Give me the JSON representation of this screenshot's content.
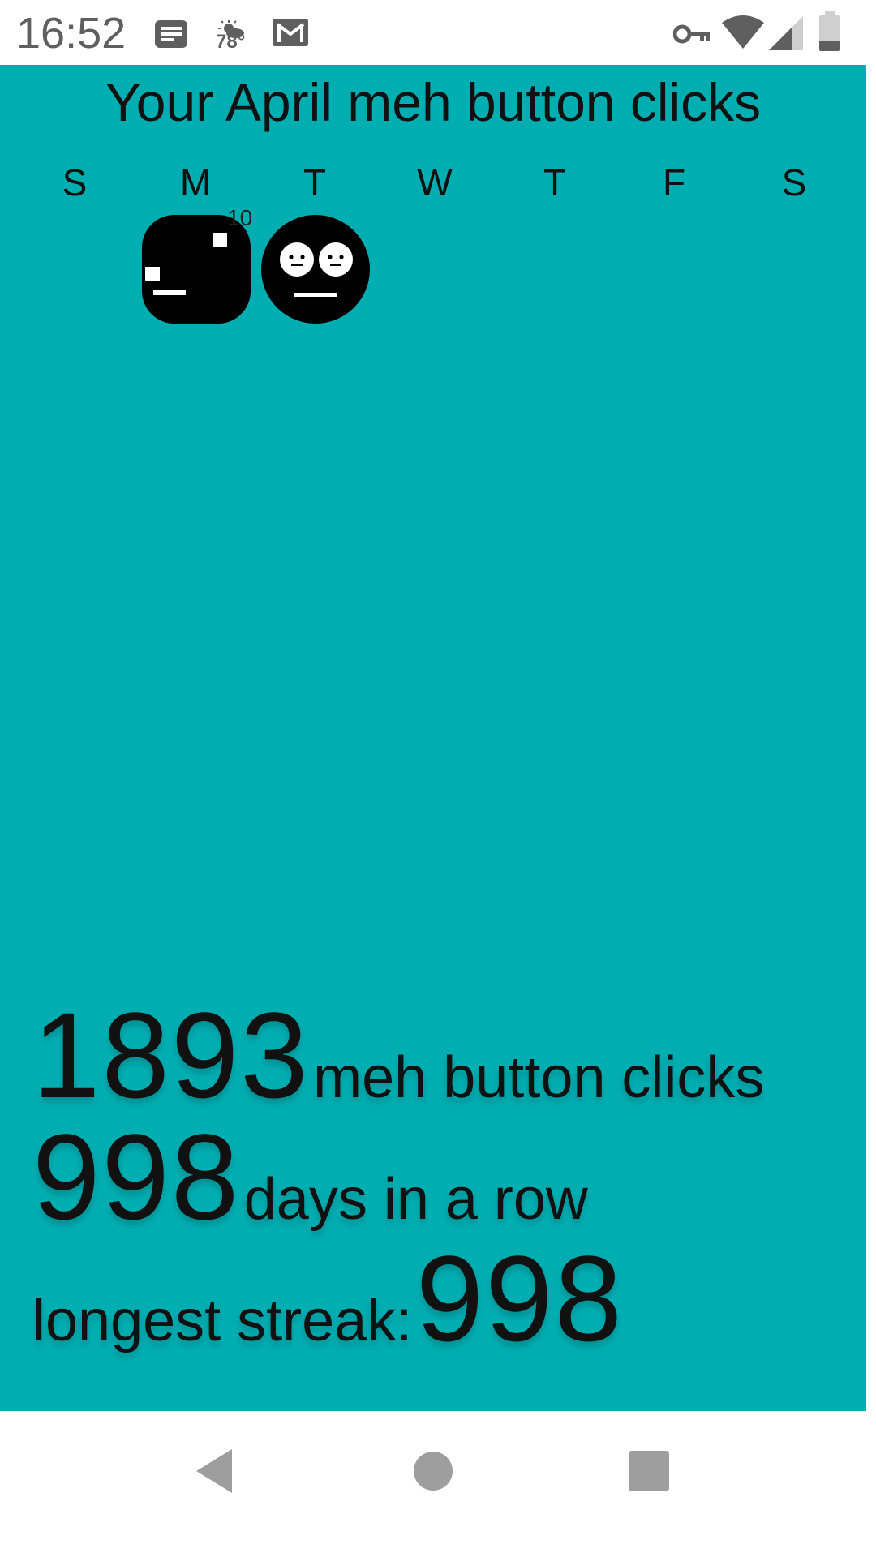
{
  "status_bar": {
    "time": "16:52",
    "weather_temp": "78°",
    "icons": [
      "message-icon",
      "weather-icon",
      "gmail-icon",
      "vpn-key-icon",
      "wifi-icon",
      "signal-icon",
      "battery-icon"
    ]
  },
  "page": {
    "title": "Your April meh button clicks"
  },
  "calendar": {
    "weekdays": [
      "S",
      "M",
      "T",
      "W",
      "T",
      "F",
      "S"
    ],
    "days": [
      {
        "label": "10",
        "icon": "meh-square-face-icon"
      },
      {
        "label": "",
        "icon": "meh-round-face-icon"
      }
    ]
  },
  "stats": {
    "clicks_count": "1893",
    "clicks_label": "meh button clicks",
    "streak_count": "998",
    "streak_label": "days in a row",
    "longest_label": "longest streak:",
    "longest_count": "998"
  },
  "nav_bar": {
    "buttons": [
      "back-icon",
      "home-icon",
      "recents-icon"
    ]
  },
  "colors": {
    "background": "#00aeb2",
    "text": "#111111",
    "status_icon": "#5f5f5f",
    "nav_icon": "#9e9e9e"
  }
}
